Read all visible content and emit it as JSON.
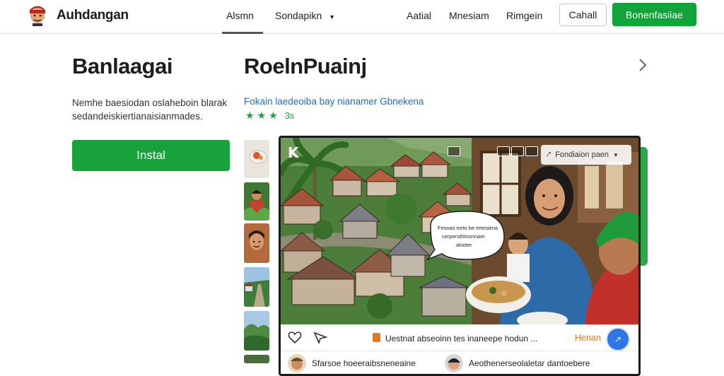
{
  "header": {
    "brand": "Auhdangan",
    "nav": [
      "Alsmn",
      "Sondapikn",
      "Aatial",
      "Mnesiam",
      "Rimgein"
    ],
    "outline_button": "Cahall",
    "primary_button": "Bonenfasiiae"
  },
  "left": {
    "title": "Banlaagai",
    "description": "Nemhe baesiodan oslaheboin blarak sedandeiskiertianaisianmades.",
    "install_label": "Instal"
  },
  "app": {
    "title": "RoelnPuainj",
    "link": "Fokain laedeoiba bay nianamer Gbnekena",
    "rating_text": "3s",
    "stars": 3
  },
  "screenshot": {
    "overlay_label": "Fondiaion paen",
    "bubble_lines": [
      "Fesoas torto be ertesiena",
      "cerpersthtnonnaer",
      "alsoter"
    ],
    "footer_text": "Uestnat abseoinn tes inaneepe hodun ...",
    "footer_link": "Henan",
    "fab_label": "↗",
    "comments": [
      "Sfarsoe hoeeraibsneneaine",
      "Aeothenerseolaletar dantoebere"
    ]
  },
  "colors": {
    "primary_green": "#12a33a",
    "link_blue": "#1a6fc4",
    "star_green": "#1aa23c",
    "fab_blue": "#2f77e8",
    "accent_orange": "#e07b16"
  }
}
